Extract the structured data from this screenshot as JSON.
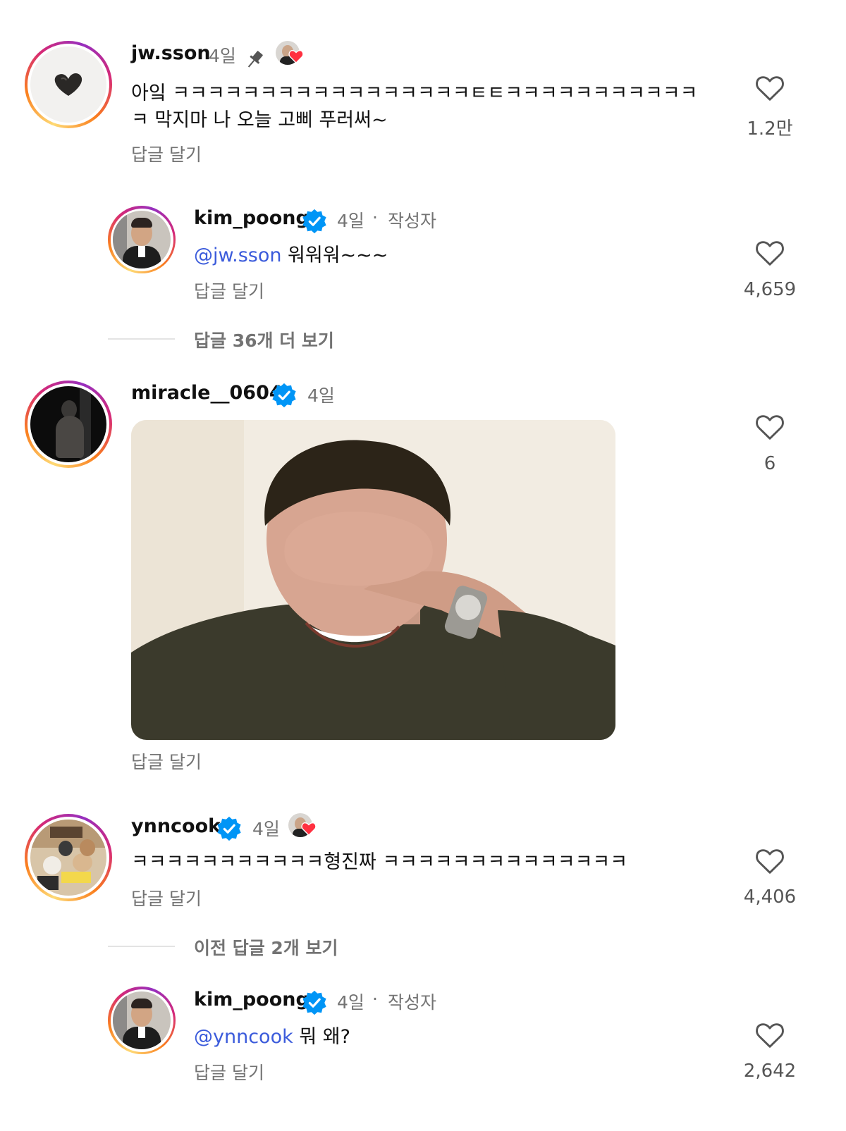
{
  "comments": [
    {
      "username": "jw.sson",
      "time": "4일",
      "text": "아잌 ㅋㅋㅋㅋㅋㅋㅋㅋㅋㅋㅋㅋㅋㅋㅋㅋㅋㅌㅌㅋㅋㅋㅋㅋㅋㅋㅋㅋㅋㅋㅋ 막지마 나 오늘 고삐 푸러써~",
      "reply_label": "답글 달기",
      "likes": "1.2만"
    },
    {
      "username": "kim_poong",
      "time": "4일",
      "author_label": "작성자",
      "mention": "@jw.sson",
      "text": " 워워워~~~",
      "reply_label": "답글 달기",
      "likes": "4,659"
    },
    {
      "username": "miracle__0604",
      "time": "4일",
      "reply_label": "답글 달기",
      "likes": "6"
    },
    {
      "username": "ynncook",
      "time": "4일",
      "text": "ㅋㅋㅋㅋㅋㅋㅋㅋㅋㅋㅋ형진짜 ㅋㅋㅋㅋㅋㅋㅋㅋㅋㅋㅋㅋㅋㅋ",
      "reply_label": "답글 달기",
      "likes": "4,406"
    },
    {
      "username": "kim_poong",
      "time": "4일",
      "author_label": "작성자",
      "mention": "@ynncook",
      "text": " 뭐 왜?",
      "reply_label": "답글 달기",
      "likes": "2,642"
    }
  ],
  "more_replies_1": "답글 36개 더 보기",
  "more_replies_2": "이전 답글 2개 보기",
  "dot": "·",
  "icons": {
    "like": "heart-outline-icon",
    "pin": "pin-icon",
    "verified": "verified-badge-icon",
    "liked_by_author": "author-liked-avatar-icon"
  },
  "colors": {
    "mention": "#3b5bdb",
    "verified": "#0095f6",
    "secondary": "#737373",
    "heart_red": "#ff3040"
  }
}
